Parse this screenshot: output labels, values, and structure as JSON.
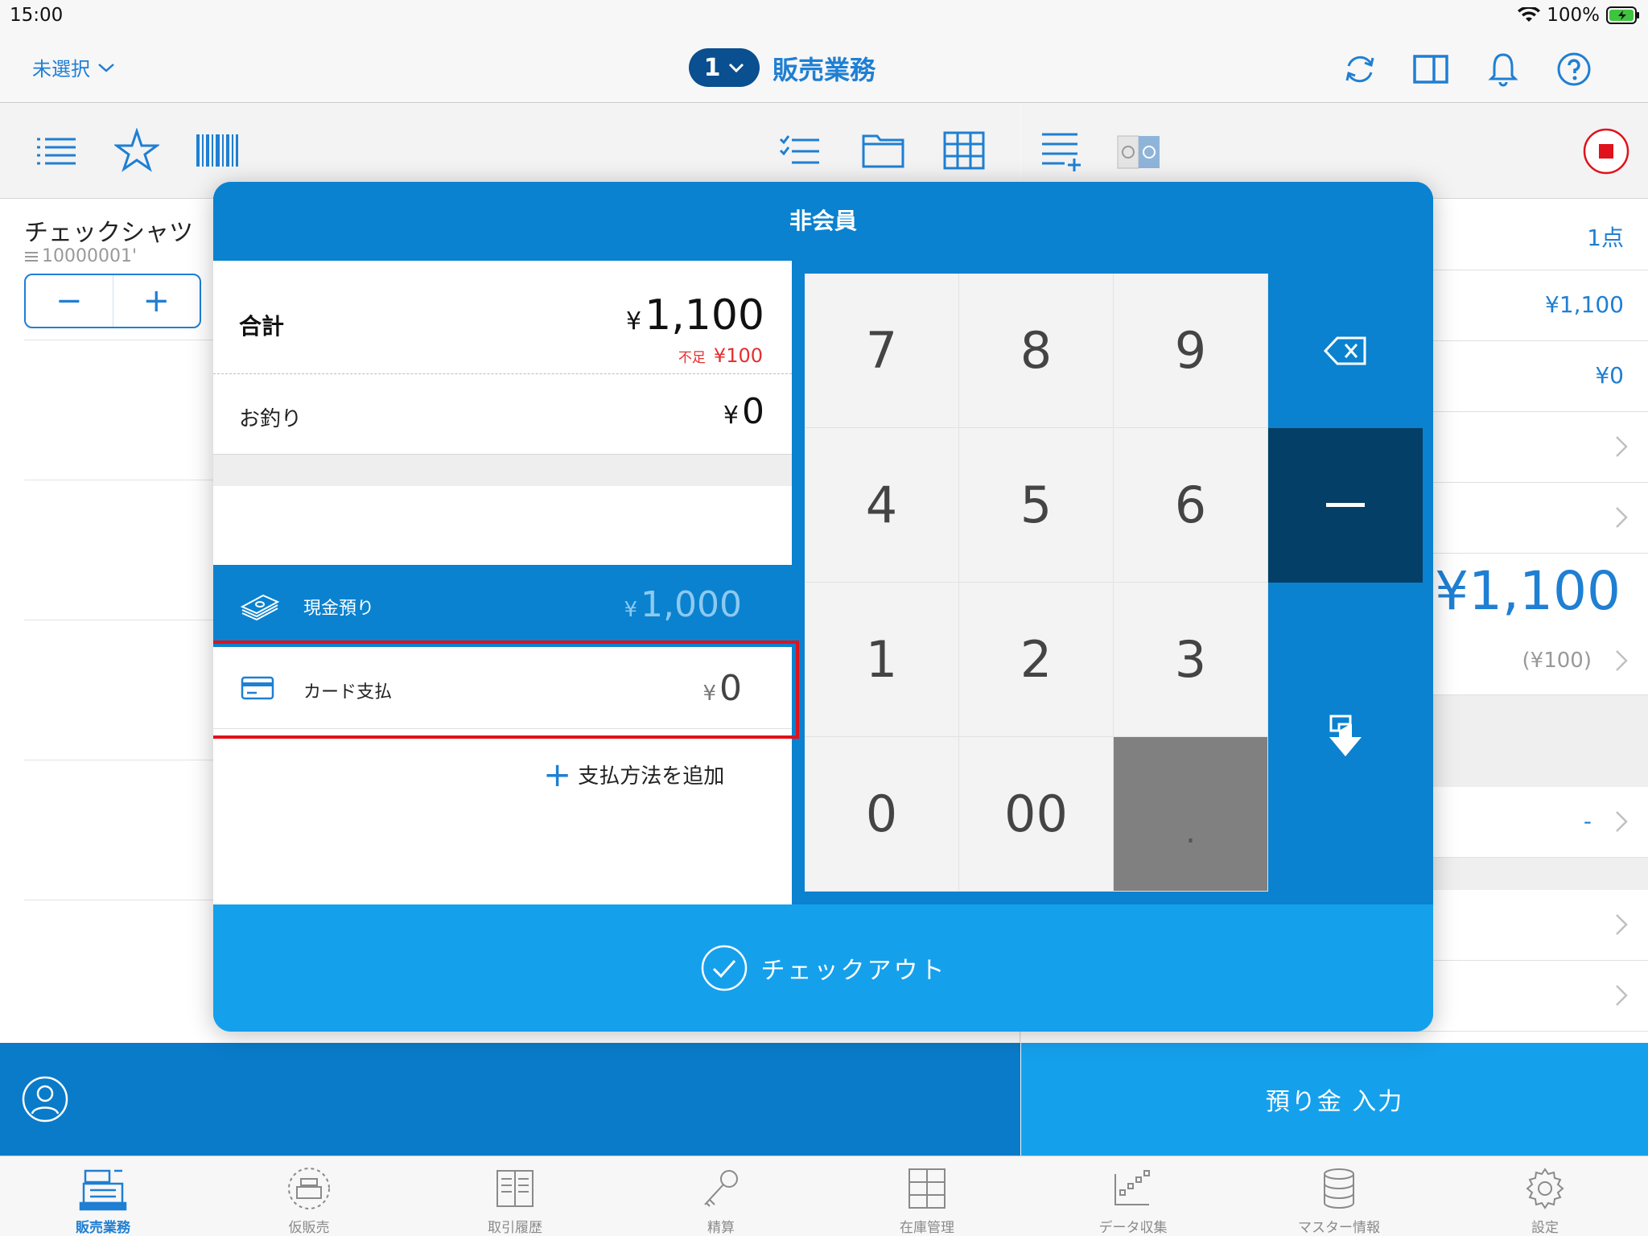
{
  "status_bar": {
    "time": "15:00",
    "battery": "100%"
  },
  "nav": {
    "customer_select": "未選択",
    "register_number": "1",
    "title": "販売業務"
  },
  "item": {
    "name": "チェックシャツ",
    "code": "10000001'",
    "minus": "−",
    "plus": "+"
  },
  "right_summary": {
    "count": "1点",
    "subtotal": "¥1,100",
    "discount": "¥0",
    "total": "¥1,100",
    "shortage": "(¥100)",
    "dash": "-"
  },
  "deposit_button": "預り金 入力",
  "modal": {
    "title": "非会員",
    "total_label": "合計",
    "total_value": "1,100",
    "yen": "¥",
    "shortage_label": "不足",
    "shortage_value": "¥100",
    "change_label": "お釣り",
    "change_value": "0",
    "payments": [
      {
        "label": "現金預り",
        "value": "1,000",
        "icon": "cash-icon"
      },
      {
        "label": "カード支払",
        "value": "0",
        "icon": "credit-card-icon"
      }
    ],
    "add_payment": "支払方法を追加",
    "keypad": [
      "7",
      "8",
      "9",
      "4",
      "5",
      "6",
      "1",
      "2",
      "3",
      "0",
      "00",
      "."
    ],
    "minus_key": "−",
    "checkout_label": "チェックアウト"
  },
  "tabs": [
    {
      "label": "販売業務",
      "icon": "register-icon",
      "active": true
    },
    {
      "label": "仮販売",
      "icon": "temp-sale-icon",
      "active": false
    },
    {
      "label": "取引履歴",
      "icon": "history-icon",
      "active": false
    },
    {
      "label": "精算",
      "icon": "key-icon",
      "active": false
    },
    {
      "label": "在庫管理",
      "icon": "inventory-icon",
      "active": false
    },
    {
      "label": "データ収集",
      "icon": "data-collect-icon",
      "active": false
    },
    {
      "label": "マスター情報",
      "icon": "database-icon",
      "active": false
    },
    {
      "label": "設定",
      "icon": "gear-icon",
      "active": false
    }
  ],
  "colors": {
    "accent": "#1f7fd3",
    "modal_blue": "#0a82cf",
    "checkout_blue": "#15a0ec",
    "highlight_red": "#e0121b",
    "shortage_red": "#e53030"
  }
}
